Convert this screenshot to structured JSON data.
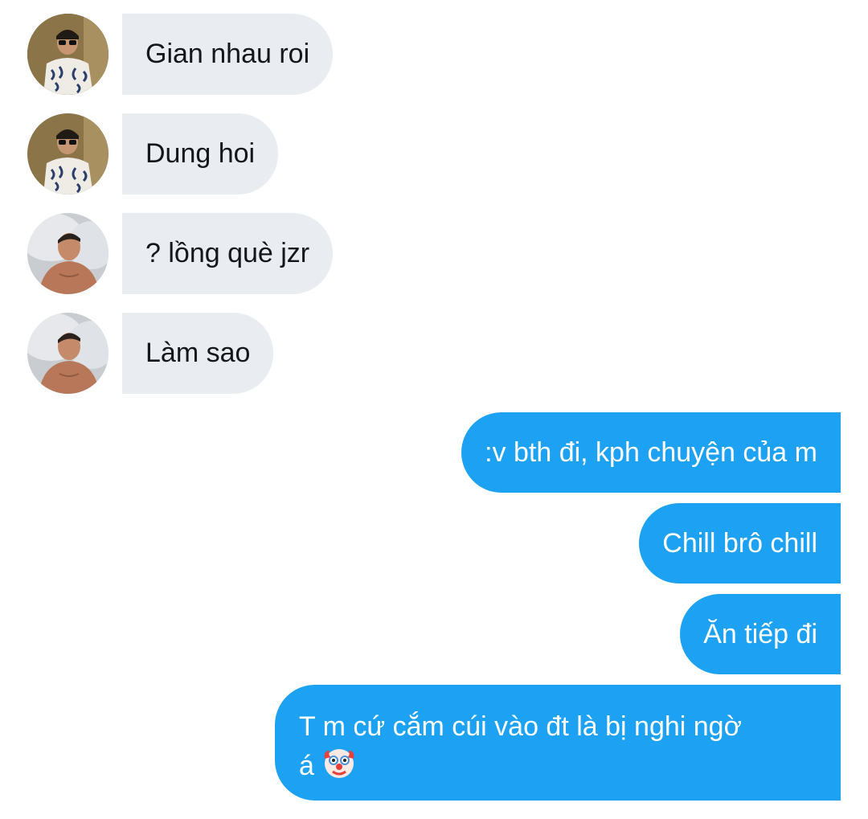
{
  "messages": [
    {
      "direction": "incoming",
      "sender_avatar": "avatar-sunglasses-shirt",
      "text": "Gian nhau roi"
    },
    {
      "direction": "incoming",
      "sender_avatar": "avatar-sunglasses-shirt",
      "text": "Dung hoi"
    },
    {
      "direction": "incoming",
      "sender_avatar": "avatar-lying-pillow",
      "text": "? lồng què jzr"
    },
    {
      "direction": "incoming",
      "sender_avatar": "avatar-lying-pillow",
      "text": "Làm sao"
    },
    {
      "direction": "outgoing",
      "text": ":v bth đi, kph chuyện của m"
    },
    {
      "direction": "outgoing",
      "text": "Chill brô chill"
    },
    {
      "direction": "outgoing",
      "text": "Ăn tiếp đi"
    },
    {
      "direction": "outgoing",
      "text_line1": "T m cứ cắm cúi vào đt là bị nghi ngờ",
      "text_line2": "á",
      "emoji": "clown-face-icon"
    }
  ],
  "colors": {
    "incoming_bubble": "#e9edf1",
    "outgoing_bubble": "#1da1f2",
    "incoming_text": "#14171a",
    "outgoing_text": "#ffffff"
  }
}
